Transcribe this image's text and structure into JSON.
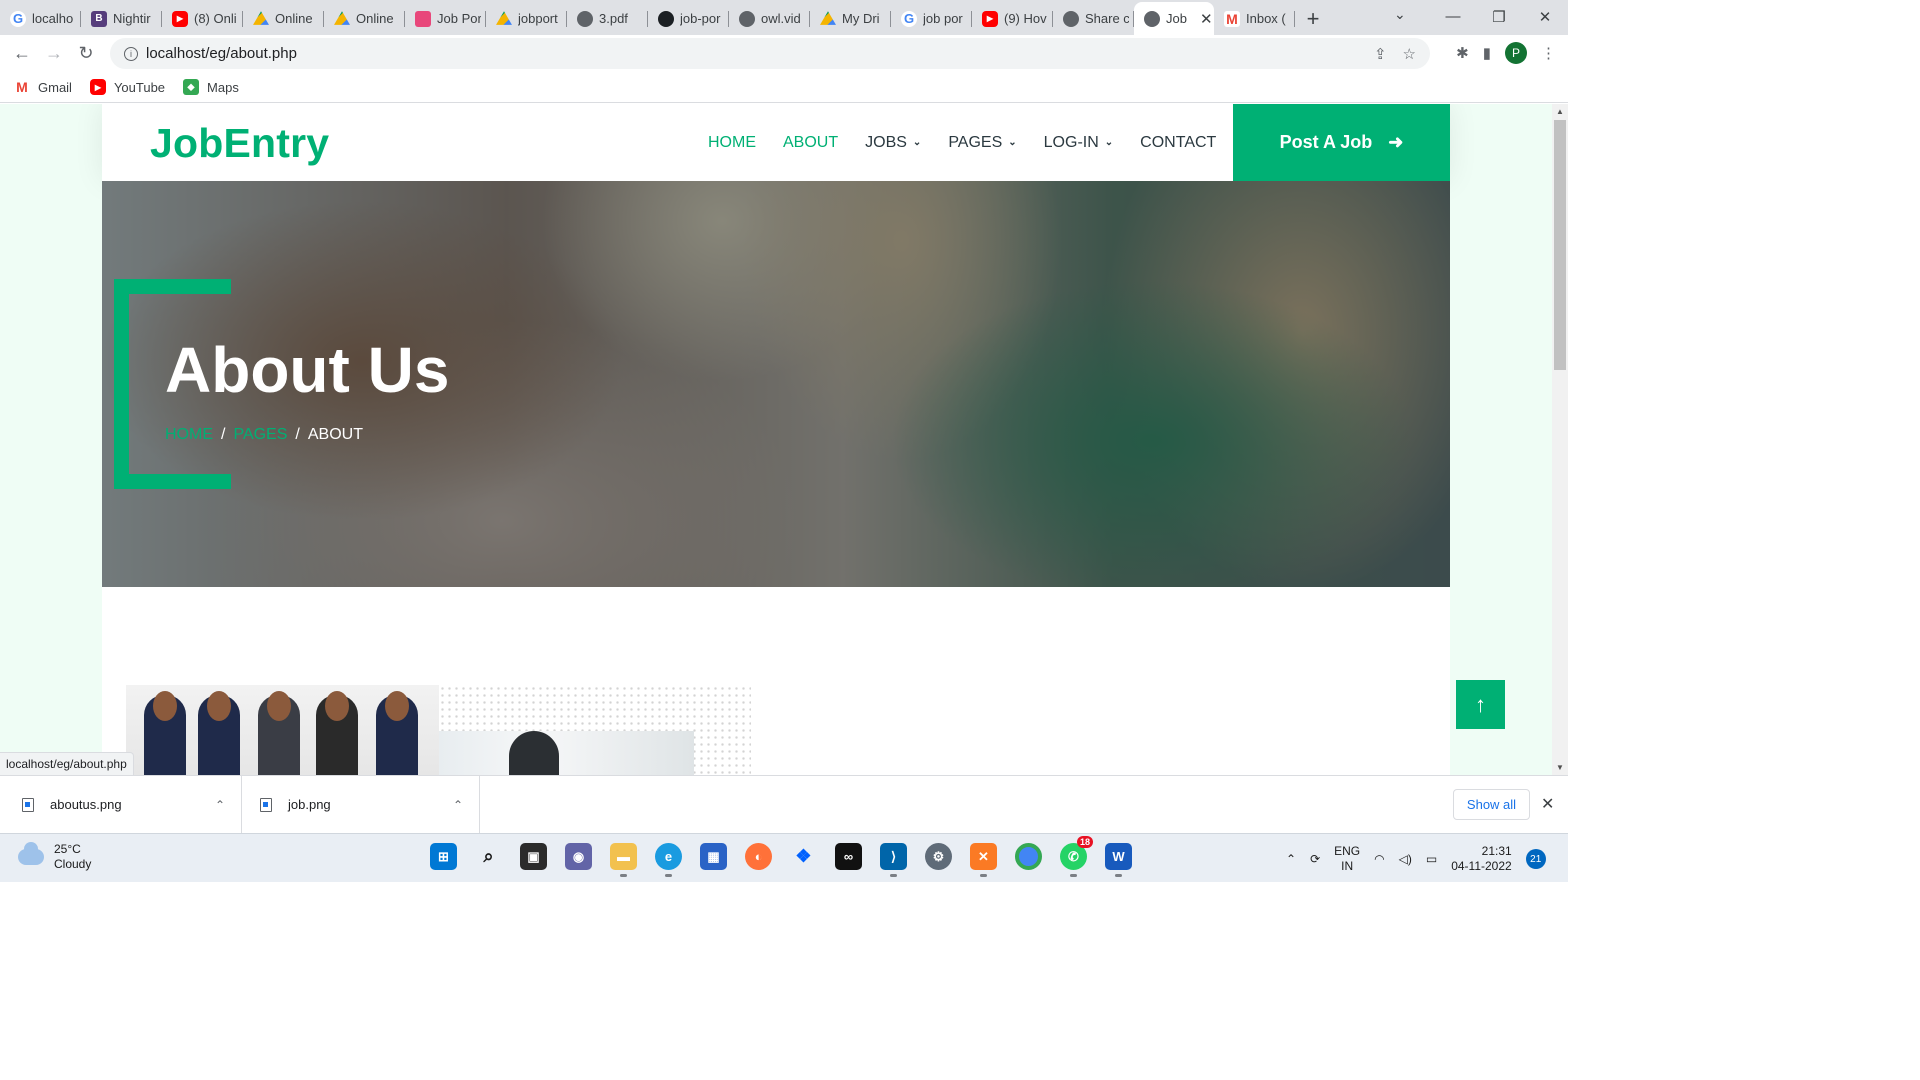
{
  "browser": {
    "tabs": [
      {
        "label": "localho",
        "favicon": "google-icon"
      },
      {
        "label": "Nightir",
        "favicon": "bootstrap-icon"
      },
      {
        "label": "(8) Onli",
        "favicon": "youtube-icon"
      },
      {
        "label": "Online",
        "favicon": "drive-icon"
      },
      {
        "label": "Online",
        "favicon": "drive-icon"
      },
      {
        "label": "Job Por",
        "favicon": "cube-icon"
      },
      {
        "label": "jobport",
        "favicon": "drive-icon"
      },
      {
        "label": "3.pdf",
        "favicon": "globe-icon"
      },
      {
        "label": "job-por",
        "favicon": "github-icon"
      },
      {
        "label": "owl.vid",
        "favicon": "globe-icon"
      },
      {
        "label": "My Dri",
        "favicon": "drive-icon"
      },
      {
        "label": "job por",
        "favicon": "google-icon"
      },
      {
        "label": "(9) Hov",
        "favicon": "youtube-icon"
      },
      {
        "label": "Share c",
        "favicon": "globe-icon"
      },
      {
        "label": "Job",
        "favicon": "globe-icon",
        "active": true
      },
      {
        "label": "Inbox (",
        "favicon": "gmail-icon"
      }
    ],
    "url": "localhost/eg/about.php",
    "profile_initial": "P",
    "bookmarks": [
      {
        "label": "Gmail",
        "icon": "gmail-icon"
      },
      {
        "label": "YouTube",
        "icon": "youtube-icon"
      },
      {
        "label": "Maps",
        "icon": "maps-icon"
      }
    ],
    "status_url": "localhost/eg/about.php"
  },
  "site": {
    "brand": "JobEntry",
    "menu": [
      {
        "label": "HOME",
        "active": true
      },
      {
        "label": "ABOUT",
        "active": true
      },
      {
        "label": "JOBS",
        "dropdown": true
      },
      {
        "label": "PAGES",
        "dropdown": true
      },
      {
        "label": "LOG-IN",
        "dropdown": true
      },
      {
        "label": "CONTACT"
      }
    ],
    "post_job": "Post A Job",
    "hero": {
      "title": "About Us",
      "breadcrumb": [
        "HOME",
        "PAGES",
        "ABOUT"
      ],
      "separator": "/"
    },
    "accent_color": "#00b074"
  },
  "downloads": {
    "items": [
      {
        "name": "aboutus.png"
      },
      {
        "name": "job.png"
      }
    ],
    "show_all": "Show all"
  },
  "taskbar": {
    "weather_temp": "25°C",
    "weather_desc": "Cloudy",
    "whatsapp_badge": "18",
    "lang_1": "ENG",
    "lang_2": "IN",
    "time": "21:31",
    "date": "04-11-2022",
    "notifications": "21"
  }
}
